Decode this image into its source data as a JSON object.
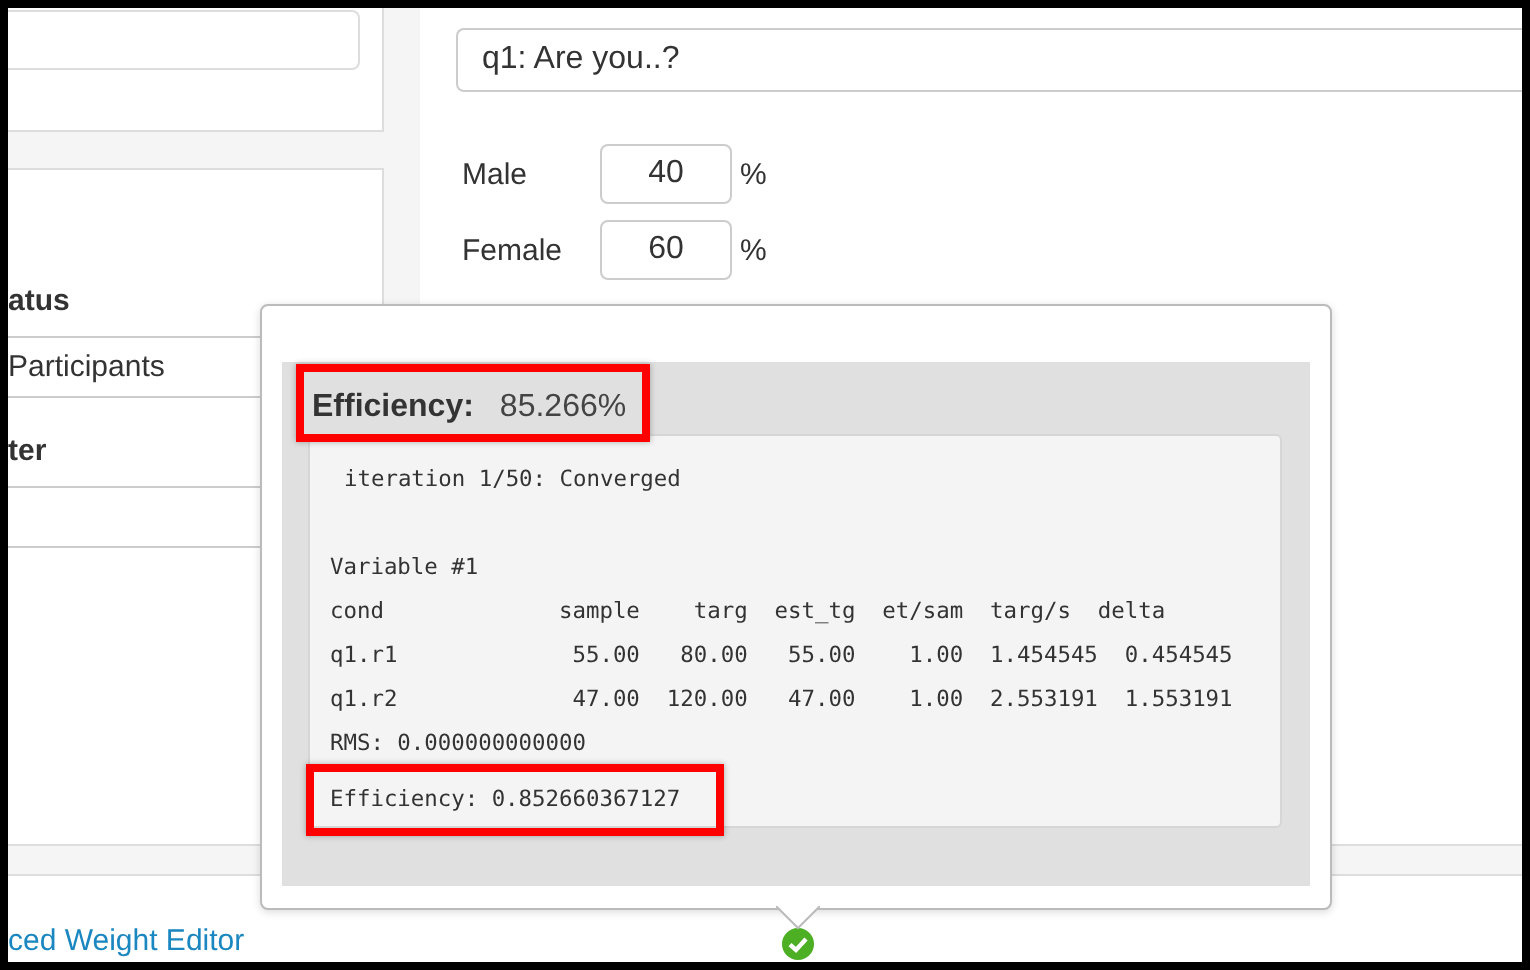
{
  "sidebar": {
    "sections": [
      {
        "heading": "atus",
        "value": "Participants"
      },
      {
        "heading": "ter"
      }
    ]
  },
  "question": {
    "value": "q1: Are you..?"
  },
  "targets": [
    {
      "label": "Male",
      "value": "40",
      "unit": "%"
    },
    {
      "label": "Female",
      "value": "60",
      "unit": "%"
    }
  ],
  "footer_link": "ced Weight Editor",
  "popover": {
    "summary": {
      "label": "Efficiency:",
      "value": "85.266%",
      "highlighted": true
    },
    "status": "iteration 1/50: Converged",
    "lines": [
      {
        "text": "Variable #1",
        "highlighted": false
      },
      {
        "text": "cond             sample    targ  est_tg  et/sam  targ/s  delta",
        "highlighted": false
      },
      {
        "text": "q1.r1             55.00   80.00   55.00    1.00  1.454545  0.454545",
        "highlighted": false
      },
      {
        "text": "q1.r2             47.00  120.00   47.00    1.00  2.553191  1.553191",
        "highlighted": false
      },
      {
        "text": "RMS: 0.000000000000",
        "highlighted": false
      },
      {
        "text": "Efficiency: 0.852660367127",
        "highlighted": true
      }
    ]
  }
}
